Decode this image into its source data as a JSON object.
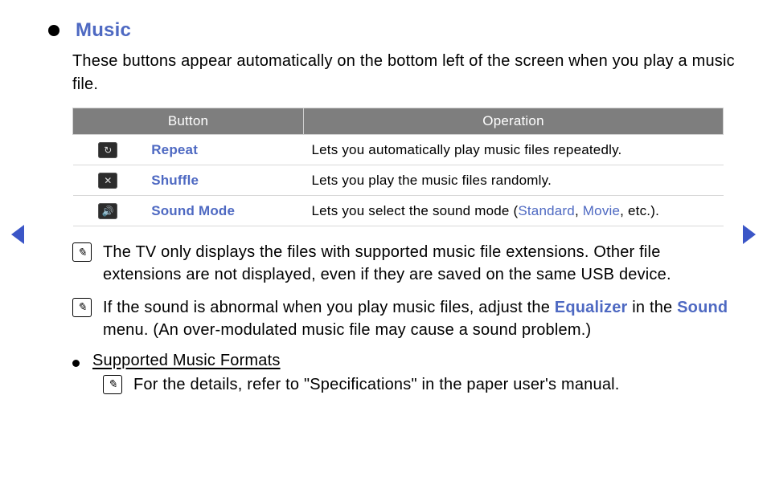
{
  "title": "Music",
  "intro": "These buttons appear automatically on the bottom left of the screen when you play a music file.",
  "table": {
    "headers": {
      "button": "Button",
      "operation": "Operation"
    },
    "rows": [
      {
        "icon": "↻",
        "label": "Repeat",
        "op_pre": "Lets you automatically play music files repeatedly.",
        "links": []
      },
      {
        "icon": "✕",
        "label": "Shuffle",
        "op_pre": "Lets you play the music files randomly.",
        "links": []
      },
      {
        "icon": "🔊",
        "label": "Sound Mode",
        "op_pre": "Lets you select the sound mode (",
        "links": [
          "Standard",
          "Movie"
        ],
        "op_post": ", etc.)."
      }
    ]
  },
  "notes": [
    {
      "text": "The TV only displays the files with supported music file extensions. Other file extensions are not displayed, even if they are saved on the same USB device."
    },
    {
      "pre": "If the sound is abnormal when you play music files, adjust the ",
      "link1": "Equalizer",
      "mid": " in the ",
      "link2": "Sound",
      "post": " menu. (An over-modulated music file may cause a sound problem.)"
    }
  ],
  "sub": {
    "heading": "Supported Music Formats",
    "note": "For the details, refer to \"Specifications\" in the paper user's manual."
  }
}
